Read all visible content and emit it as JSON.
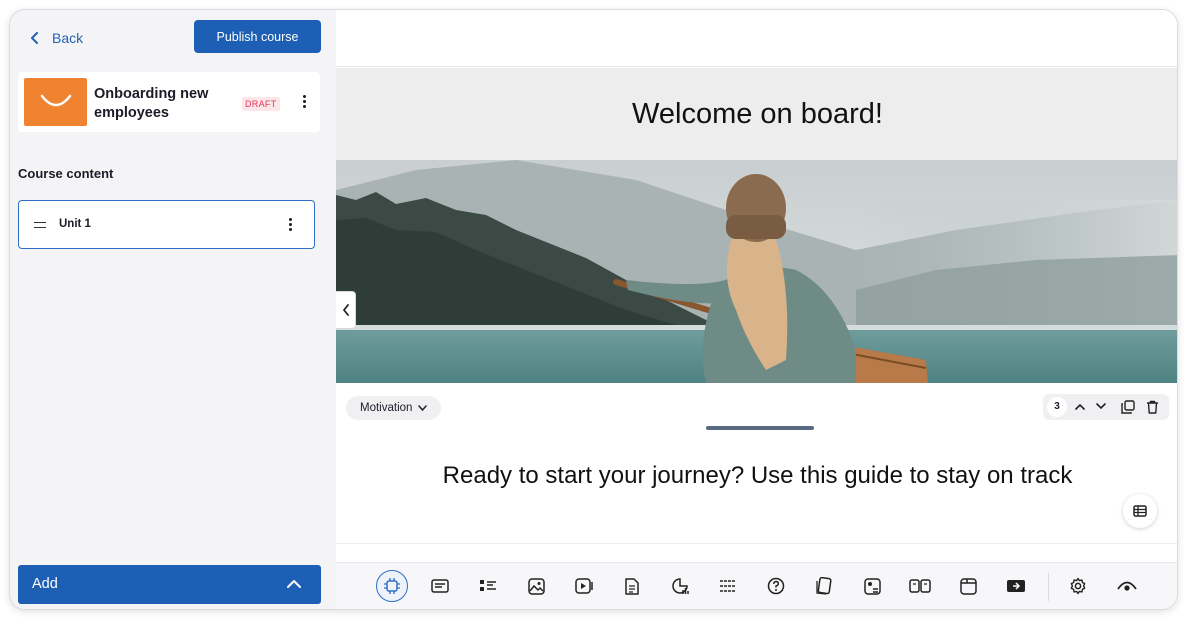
{
  "sidebar": {
    "back_label": "Back",
    "publish_label": "Publish course",
    "course": {
      "title": "Onboarding new employees",
      "status": "DRAFT",
      "thumb_color": "#f0832f"
    },
    "section_title": "Course content",
    "units": [
      {
        "label": "Unit 1"
      }
    ],
    "add_label": "Add"
  },
  "main": {
    "heading": "Welcome on board!",
    "block_type": "Motivation",
    "block_number": "3",
    "subtitle": "Ready to start your journey? Use this guide to stay on track"
  },
  "toolbar": {
    "items": [
      "ai-icon",
      "text-icon",
      "list-icon",
      "image-icon",
      "video-icon",
      "document-icon",
      "chart-icon",
      "divider-icon",
      "quiz-icon",
      "flashcards-icon",
      "image-text-icon",
      "columns-icon",
      "tab-icon",
      "embed-icon",
      "settings-icon",
      "preview-icon"
    ]
  },
  "colors": {
    "primary": "#1d5fb4",
    "draft": "#e0385a",
    "sidebar_bg": "#f4f4f6"
  }
}
